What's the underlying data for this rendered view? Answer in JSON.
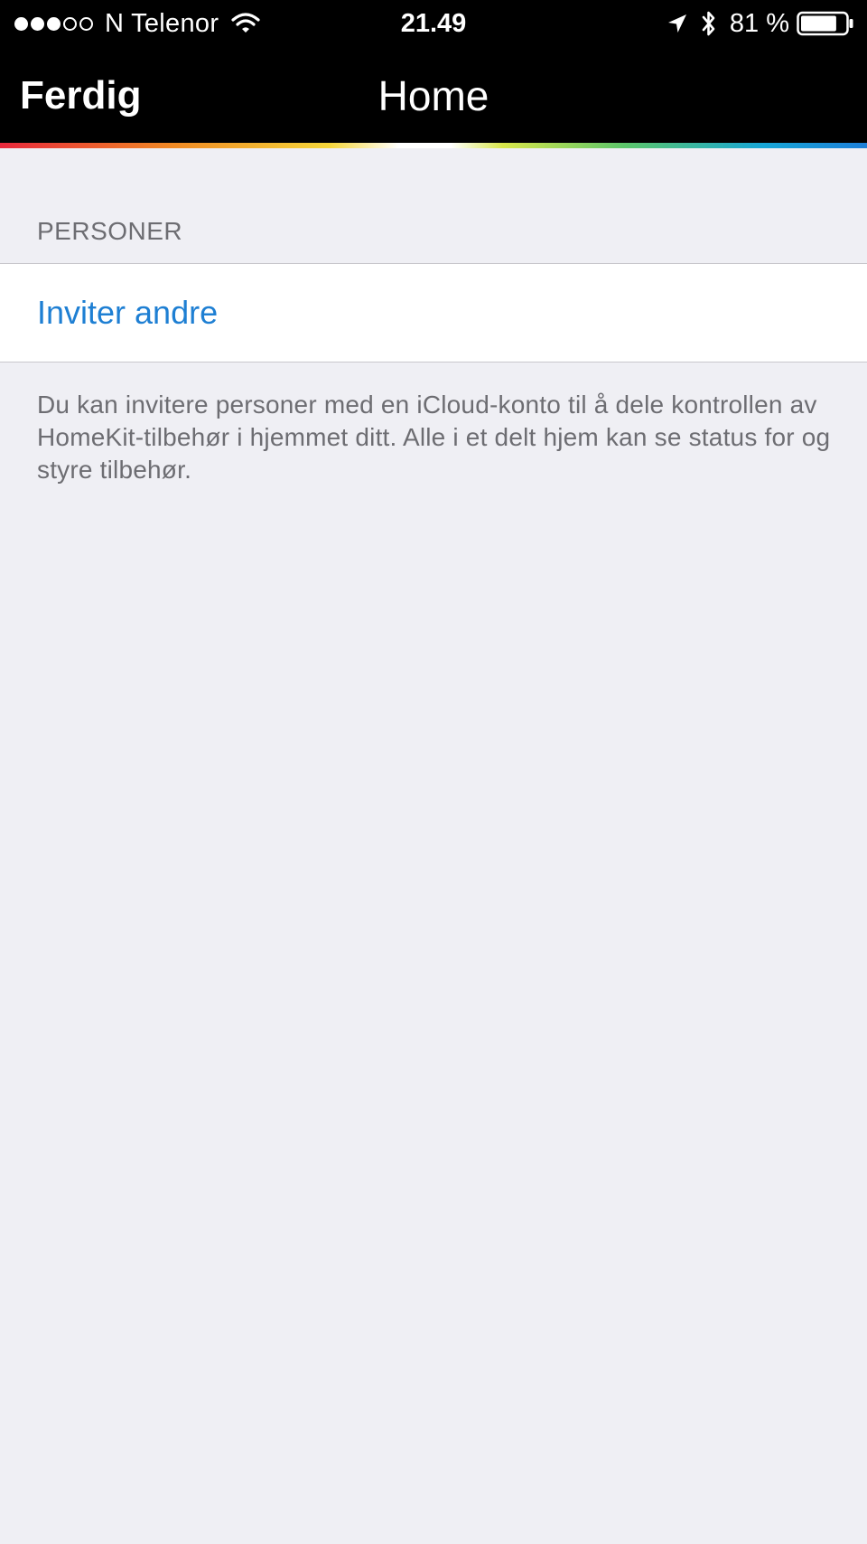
{
  "status_bar": {
    "carrier": "N Telenor",
    "time": "21.49",
    "battery_percent": "81 %",
    "battery_level": 0.81,
    "signal_filled": 3,
    "signal_total": 5
  },
  "nav": {
    "back_label": "Ferdig",
    "title": "Home"
  },
  "section": {
    "header": "PERSONER",
    "invite_label": "Inviter andre",
    "footer": "Du kan invitere personer med en iCloud-konto til å dele kontrollen av HomeKit-tilbehør i hjemmet ditt. Alle i et delt hjem kan se status for og styre tilbehør."
  },
  "colors": {
    "link": "#1e7fd3",
    "background": "#efeff4",
    "header_bg": "#000000"
  }
}
